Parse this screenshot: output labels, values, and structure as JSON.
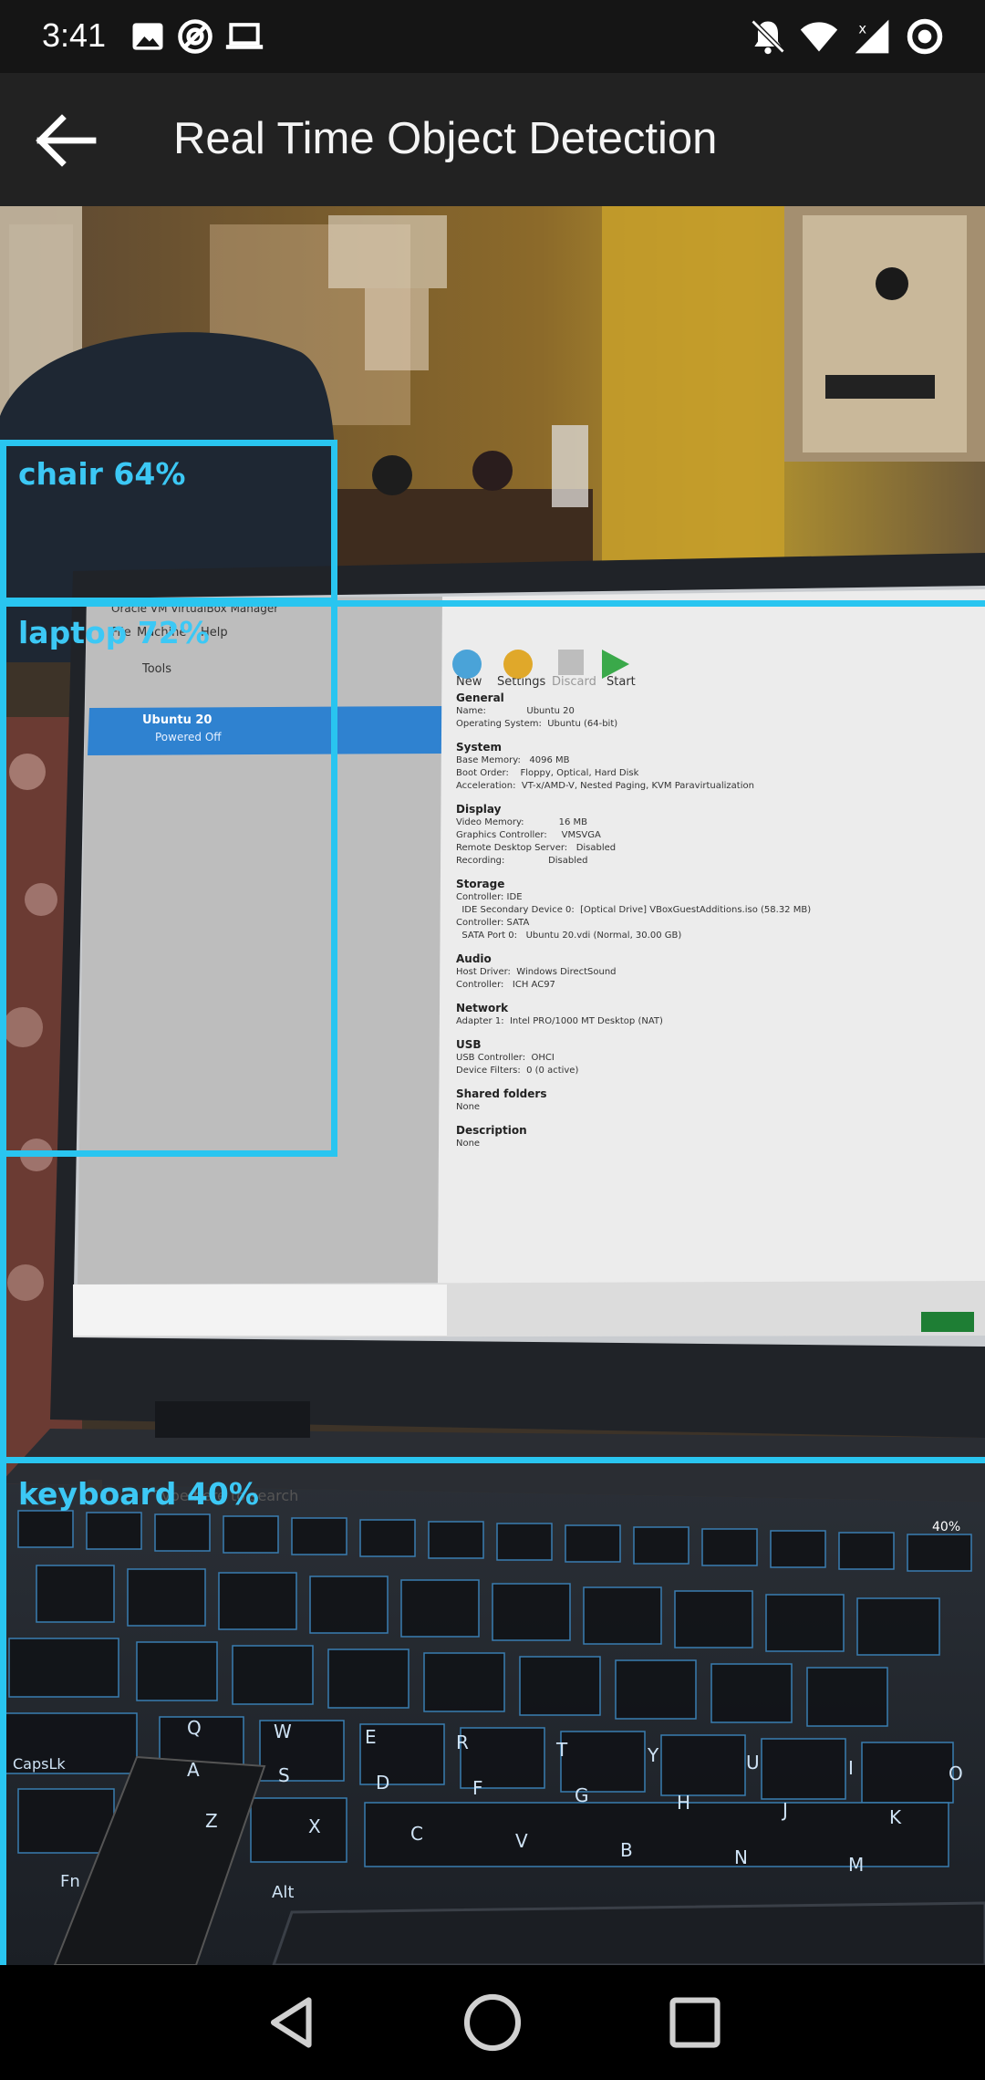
{
  "status_bar": {
    "time": "3:41",
    "left_icons": [
      "image-icon",
      "sync-icon",
      "laptop-icon"
    ],
    "right_icons": [
      "mute-icon",
      "wifi-icon",
      "signal-icon",
      "data-saver-icon"
    ]
  },
  "app_bar": {
    "title": "Real Time Object Detection",
    "back_icon": "arrow-back-icon"
  },
  "detections": [
    {
      "label": "chair 64%",
      "object": "chair",
      "confidence": 0.64
    },
    {
      "label": "laptop 72%",
      "object": "laptop",
      "confidence": 0.72
    },
    {
      "label": "keyboard 40%",
      "object": "keyboard",
      "confidence": 0.4
    }
  ],
  "laptop_screen": {
    "window_title": "Oracle VM VirtualBox Manager",
    "menu": [
      "File",
      "Machine",
      "Help"
    ],
    "tools_label": "Tools",
    "vm_name": "Ubuntu 20",
    "vm_state": "Powered Off",
    "toolbar": [
      "New",
      "Settings",
      "Discard",
      "Start"
    ],
    "sections": [
      {
        "title": "General",
        "rows": [
          "Name:              Ubuntu 20",
          "Operating System:  Ubuntu (64-bit)"
        ]
      },
      {
        "title": "System",
        "rows": [
          "Base Memory:   4096 MB",
          "Boot Order:    Floppy, Optical, Hard Disk",
          "Acceleration:  VT-x/AMD-V, Nested Paging, KVM Paravirtualization"
        ]
      },
      {
        "title": "Display",
        "rows": [
          "Video Memory:            16 MB",
          "Graphics Controller:     VMSVGA",
          "Remote Desktop Server:   Disabled",
          "Recording:               Disabled"
        ]
      },
      {
        "title": "Storage",
        "rows": [
          "Controller: IDE",
          "  IDE Secondary Device 0:  [Optical Drive] VBoxGuestAdditions.iso (58.32 MB)",
          "Controller: SATA",
          "  SATA Port 0:   Ubuntu 20.vdi (Normal, 30.00 GB)"
        ]
      },
      {
        "title": "Audio",
        "rows": [
          "Host Driver:  Windows DirectSound",
          "Controller:   ICH AC97"
        ]
      },
      {
        "title": "Network",
        "rows": [
          "Adapter 1:  Intel PRO/1000 MT Desktop (NAT)"
        ]
      },
      {
        "title": "USB",
        "rows": [
          "USB Controller:  OHCI",
          "Device Filters:  0 (0 active)"
        ]
      },
      {
        "title": "Shared folders",
        "rows": [
          "None"
        ]
      },
      {
        "title": "Description",
        "rows": [
          "None"
        ]
      }
    ],
    "taskbar_search": "Type here to search",
    "battery": "40%"
  },
  "keyboard_keys": [
    "Q",
    "W",
    "E",
    "R",
    "T",
    "Y",
    "U",
    "I",
    "O",
    "A",
    "S",
    "D",
    "F",
    "G",
    "H",
    "J",
    "K",
    "Z",
    "X",
    "C",
    "V",
    "B",
    "N",
    "M",
    "CapsLk",
    "Fn",
    "Alt"
  ],
  "colors": {
    "detection_box": "#29c5f0",
    "detection_label": "#3cc8f5",
    "app_bar": "#222222",
    "status_bar": "#151515",
    "nav_bar": "#000000"
  },
  "nav_bar": {
    "buttons": [
      "back-triangle-icon",
      "home-circle-icon",
      "recents-square-icon"
    ]
  }
}
